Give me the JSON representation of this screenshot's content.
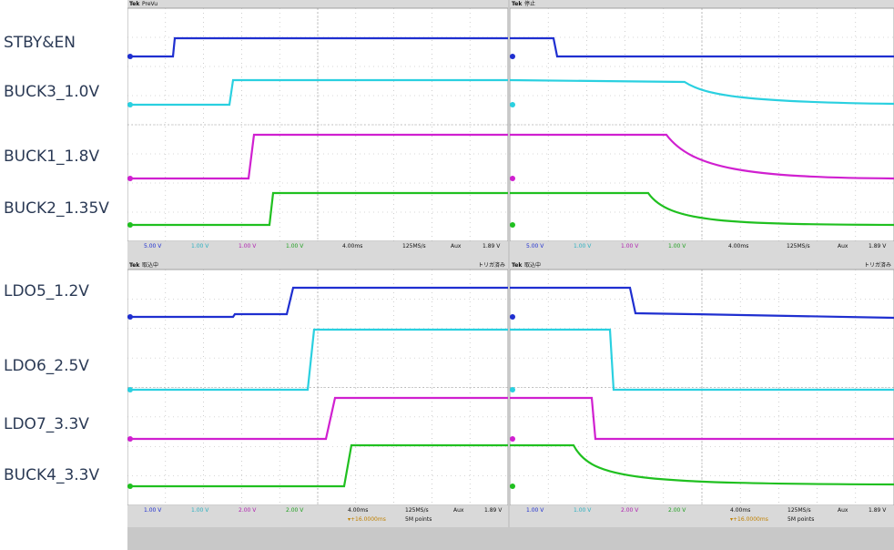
{
  "labels": {
    "top": [
      "STBY&EN",
      "BUCK3_1.0V",
      "BUCK1_1.8V",
      "BUCK2_1.35V"
    ],
    "bottom": [
      "LDO5_1.2V",
      "LDO6_2.5V",
      "LDO7_3.3V",
      "BUCK4_3.3V"
    ]
  },
  "colors": {
    "ch1": "#1f2fd0",
    "ch2": "#2ad0e0",
    "ch3": "#d020d0",
    "ch4": "#20c020"
  },
  "scopes": {
    "top_left": {
      "brand": "Tek",
      "state": "PreVu",
      "trigger_status": "",
      "ch_scales": [
        "5.00 V",
        "1.00 V",
        "1.00 V",
        "1.00 V"
      ],
      "timebase": "4.00ms",
      "delay": "",
      "sample_rate": "125MS/s",
      "points": "",
      "trigger_source": "Aux",
      "trigger_level": "1.89 V"
    },
    "top_right": {
      "brand": "Tek",
      "state": "停止",
      "trigger_status": "",
      "ch_scales": [
        "5.00 V",
        "1.00 V",
        "1.00 V",
        "1.00 V"
      ],
      "timebase": "4.00ms",
      "delay": "",
      "sample_rate": "125MS/s",
      "points": "",
      "trigger_source": "Aux",
      "trigger_level": "1.89 V"
    },
    "bottom_left": {
      "brand": "Tek",
      "state": "取込中",
      "trigger_status": "トリガ済み",
      "ch_scales": [
        "1.00 V",
        "1.00 V",
        "2.00 V",
        "2.00 V"
      ],
      "timebase": "4.00ms",
      "delay": "▾+16.0000ms",
      "sample_rate": "125MS/s",
      "points": "5M points",
      "trigger_source": "Aux",
      "trigger_level": "1.89 V"
    },
    "bottom_right": {
      "brand": "Tek",
      "state": "取込中",
      "trigger_status": "トリガ済み",
      "ch_scales": [
        "1.00 V",
        "1.00 V",
        "2.00 V",
        "2.00 V"
      ],
      "timebase": "4.00ms",
      "delay": "▾+16.0000ms",
      "sample_rate": "125MS/s",
      "points": "5M points",
      "trigger_source": "Aux",
      "trigger_level": "1.89 V"
    }
  }
}
